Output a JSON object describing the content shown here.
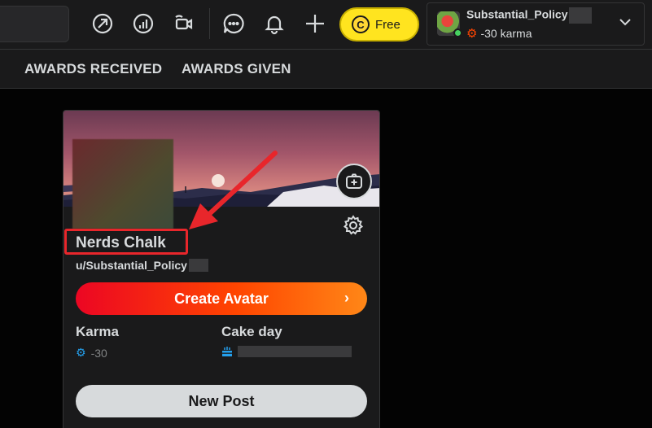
{
  "header": {
    "free_label": "Free",
    "coin_glyph": "C",
    "username": "Substantial_Policy",
    "karma_label": "-30 karma",
    "icons": [
      "popular-icon",
      "stats-icon",
      "live-icon",
      "chat-icon",
      "notifications-icon",
      "create-post-icon"
    ]
  },
  "tabs": [
    {
      "label": "AWARDS RECEIVED"
    },
    {
      "label": "AWARDS GIVEN"
    }
  ],
  "profile": {
    "display_name": "Nerds Chalk",
    "handle": "u/Substantial_Policy",
    "create_avatar_label": "Create Avatar",
    "karma_title": "Karma",
    "karma_value": "-30",
    "cake_title": "Cake day",
    "new_post_label": "New Post"
  },
  "colors": {
    "accent_orange": "#ff4500",
    "free_yellow": "#ffe41f",
    "highlight_red": "#e8262b",
    "online_green": "#46d160"
  }
}
